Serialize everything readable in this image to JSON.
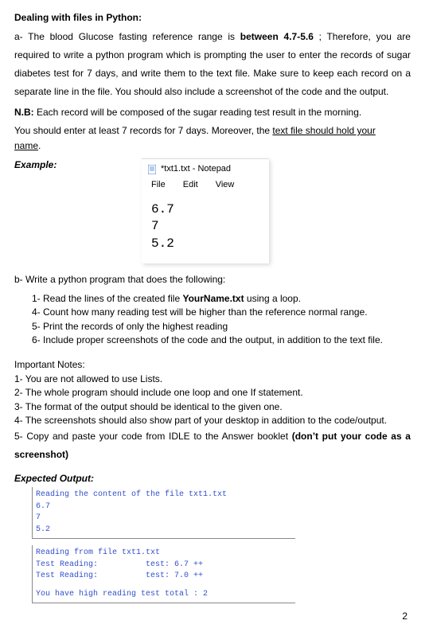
{
  "title": "Dealing with files in Python:",
  "para_a_pre": "a- The blood Glucose fasting reference range is ",
  "para_a_bold": "between 4.7-5.6",
  "para_a_post": " ; Therefore, you are required to write a python program which is prompting the user to enter the records of sugar diabetes test for 7 days, and write them to the text file. Make sure to keep each record on a separate line in the file. You should also include a screenshot of the code and the output.",
  "nb_label": "N.B:",
  "nb_text": " Each record will be composed of the sugar reading test result in the morning.",
  "line7_pre": "You should enter at least 7 records for 7 days. Moreover, the ",
  "line7_u1": "text file should hold your",
  "line7_u2": "name",
  "example_label": "Example:",
  "notepad": {
    "title": "*txt1.txt - Notepad",
    "menu": {
      "file": "File",
      "edit": "Edit",
      "view": "View"
    },
    "lines": {
      "l1": "6.7",
      "l2": "7",
      "l3": "5.2"
    }
  },
  "part_b_intro": "b- Write a python program that does the following:",
  "b1_pre": "1- Read the lines of the created file ",
  "b1_bold": "YourName.txt",
  "b1_post": " using a loop.",
  "b4": "4- Count how many reading test will be higher than the reference normal range.",
  "b5": "5- Print the records of only the highest reading",
  "b6": "6- Include proper screenshots of the code and the output, in addition to the text file.",
  "notes_heading": "Important Notes:",
  "n1": "1- You are not allowed to use Lists.",
  "n2": "2- The whole program should include one loop and one If statement.",
  "n3": "3- The format of the output should be identical to the given one.",
  "n4": "4- The screenshots should also show part of your desktop in addition to the code/output.",
  "n5_pre": "5- Copy and paste your code from IDLE to the Answer booklet ",
  "n5_bold": "(don’t put your code as a screenshot)",
  "expected_label": "Expected Output:",
  "out1": "Reading the content of the file txt1.txt",
  "out2": "6.7",
  "out3": "7",
  "out4": "5.2",
  "out5": "Reading from file txt1.txt",
  "out6": "Test Reading:          test: 6.7 ++",
  "out7": "Test Reading:          test: 7.0 ++",
  "out8": "You have high reading test total : 2",
  "page_num": "2"
}
